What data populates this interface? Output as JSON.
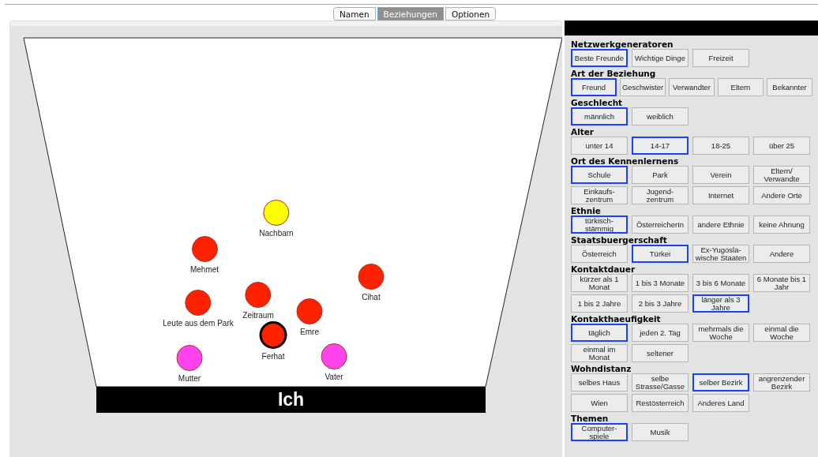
{
  "tabs": [
    {
      "label": "Namen",
      "selected": false
    },
    {
      "label": "Beziehungen",
      "selected": true
    },
    {
      "label": "Optionen",
      "selected": false
    }
  ],
  "canvas": {
    "base_label": "Ich",
    "nodes": [
      {
        "label": "Nachbarn",
        "color": "#ffff00",
        "selected": false
      },
      {
        "label": "Mehmet",
        "color": "#ff2200",
        "selected": false
      },
      {
        "label": "Cihat",
        "color": "#ff2200",
        "selected": false
      },
      {
        "label": "Leute aus dem Park",
        "color": "#ff2200",
        "selected": false
      },
      {
        "label": "Zeitraum",
        "color": "#ff2200",
        "selected": false
      },
      {
        "label": "Emre",
        "color": "#ff2200",
        "selected": false
      },
      {
        "label": "Ferhat",
        "color": "#ff2200",
        "selected": true
      },
      {
        "label": "Mutter",
        "color": "#ff44ee",
        "selected": false
      },
      {
        "label": "Vater",
        "color": "#ff44ee",
        "selected": false
      }
    ]
  },
  "sections": [
    {
      "title": "Netzwerkgeneratoren",
      "options": [
        {
          "label": "Beste Freunde",
          "selected": true
        },
        {
          "label": "Wichtige Dinge",
          "selected": false
        },
        {
          "label": "Freizeit",
          "selected": false
        }
      ]
    },
    {
      "title": "Art der Beziehung",
      "options": [
        {
          "label": "Freund",
          "selected": true
        },
        {
          "label": "Geschwister",
          "selected": false
        },
        {
          "label": "Verwandter",
          "selected": false
        },
        {
          "label": "Eltern",
          "selected": false
        },
        {
          "label": "Bekannter",
          "selected": false
        }
      ]
    },
    {
      "title": "Geschlecht",
      "options": [
        {
          "label": "männlich",
          "selected": true
        },
        {
          "label": "weiblich",
          "selected": false
        }
      ]
    },
    {
      "title": "Alter",
      "options": [
        {
          "label": "unter 14",
          "selected": false
        },
        {
          "label": "14-17",
          "selected": true
        },
        {
          "label": "18-25",
          "selected": false
        },
        {
          "label": "über 25",
          "selected": false
        }
      ]
    },
    {
      "title": "Ort des Kennenlernens",
      "options": [
        {
          "label": "Schule",
          "selected": true
        },
        {
          "label": "Park",
          "selected": false
        },
        {
          "label": "Verein",
          "selected": false
        },
        {
          "label": "Eltern/ Verwandte",
          "selected": false
        },
        {
          "label": "Einkaufs-zentrum",
          "selected": false
        },
        {
          "label": "Jugend-zentrum",
          "selected": false
        },
        {
          "label": "Internet",
          "selected": false
        },
        {
          "label": "Andere Orte",
          "selected": false
        }
      ]
    },
    {
      "title": "Ethnie",
      "options": [
        {
          "label": "türkisch-stämmig",
          "selected": true
        },
        {
          "label": "ÖsterreicherIn",
          "selected": false
        },
        {
          "label": "andere Ethnie",
          "selected": false
        },
        {
          "label": "keine Ahnung",
          "selected": false
        }
      ]
    },
    {
      "title": "Staatsbuergerschaft",
      "options": [
        {
          "label": "Österreich",
          "selected": false
        },
        {
          "label": "Türkei",
          "selected": true
        },
        {
          "label": "Ex-Yugosla-wische Staaten",
          "selected": false
        },
        {
          "label": "Andere",
          "selected": false
        }
      ]
    },
    {
      "title": "Kontaktdauer",
      "options": [
        {
          "label": "kürzer als 1 Monat",
          "selected": false
        },
        {
          "label": "1 bis 3 Monate",
          "selected": false
        },
        {
          "label": "3 bis 6 Monate",
          "selected": false
        },
        {
          "label": "6 Monate bis 1 Jahr",
          "selected": false
        },
        {
          "label": "1 bis 2 Jahre",
          "selected": false
        },
        {
          "label": "2 bis 3 Jahre",
          "selected": false
        },
        {
          "label": "länger als 3 Jahre",
          "selected": true
        }
      ]
    },
    {
      "title": "Kontakthaeufigkeit",
      "options": [
        {
          "label": "täglich",
          "selected": true
        },
        {
          "label": "jeden 2. Tag",
          "selected": false
        },
        {
          "label": "mehrmals die Woche",
          "selected": false
        },
        {
          "label": "einmal die Woche",
          "selected": false
        },
        {
          "label": "einmal im Monat",
          "selected": false
        },
        {
          "label": "seltener",
          "selected": false
        }
      ]
    },
    {
      "title": "Wohndistanz",
      "options": [
        {
          "label": "selbes Haus",
          "selected": false
        },
        {
          "label": "selbe Strasse/Gasse",
          "selected": false
        },
        {
          "label": "selber Bezirk",
          "selected": true
        },
        {
          "label": "angrenzender Bezirk",
          "selected": false
        },
        {
          "label": "Wien",
          "selected": false
        },
        {
          "label": "Restösterreich",
          "selected": false
        },
        {
          "label": "Anderes Land",
          "selected": false
        }
      ]
    },
    {
      "title": "Themen",
      "options": [
        {
          "label": "Computer-spiele",
          "selected": true
        },
        {
          "label": "Musik",
          "selected": false
        }
      ]
    }
  ]
}
